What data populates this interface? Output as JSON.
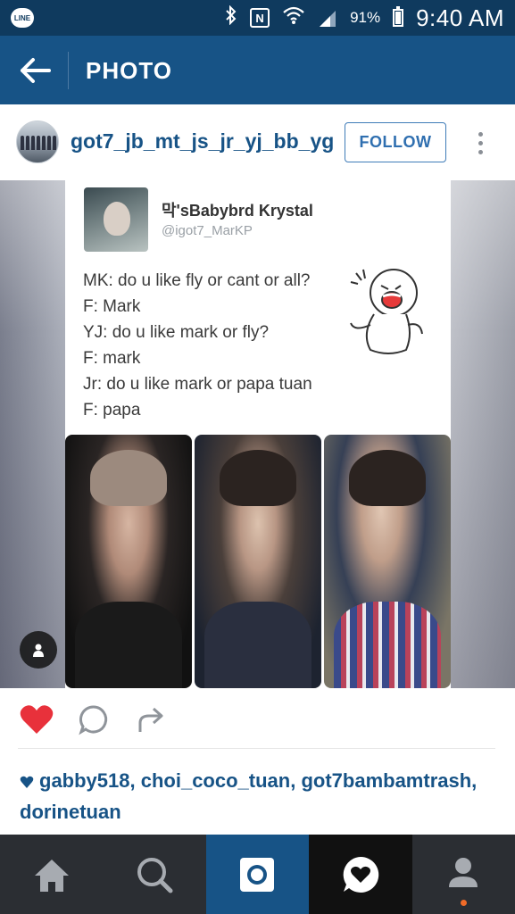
{
  "status_bar": {
    "app_badge": "LINE",
    "battery_percent": "91%",
    "time": "9:40 AM",
    "icons": [
      "line-icon",
      "bluetooth-icon",
      "nfc-icon",
      "wifi-icon",
      "signal-icon",
      "battery-icon"
    ]
  },
  "app_bar": {
    "title": "PHOTO",
    "back_icon": "back-arrow-icon"
  },
  "post": {
    "username": "got7_jb_mt_js_jr_yj_bb_yg",
    "follow_label": "FOLLOW",
    "more_icon": "more-vertical-icon"
  },
  "tweet": {
    "display_name": "막'sBabybrd Krystal",
    "handle": "@igot7_MarKP",
    "lines": [
      "MK: do u like fly or cant or all?",
      "F: Mark",
      "YJ: do u like mark or fly?",
      "F: mark",
      "Jr: do u like mark or papa tuan",
      "F: papa"
    ]
  },
  "actions": {
    "like_icon": "heart-filled-icon",
    "comment_icon": "comment-icon",
    "share_icon": "share-icon",
    "like_color": "#e8313b"
  },
  "likes": {
    "users": [
      "gabby518",
      "choi_coco_tuan",
      "got7bambamtrash",
      "dorinetuan"
    ]
  },
  "bottom_nav": {
    "tabs": [
      "home-icon",
      "search-icon",
      "camera-icon",
      "activity-heart-icon",
      "profile-icon"
    ],
    "active_color": "#175386"
  },
  "colors": {
    "status_bar": "#0f3a5e",
    "app_bar": "#175386",
    "link": "#175386",
    "nav_bg": "#2b2e33"
  }
}
